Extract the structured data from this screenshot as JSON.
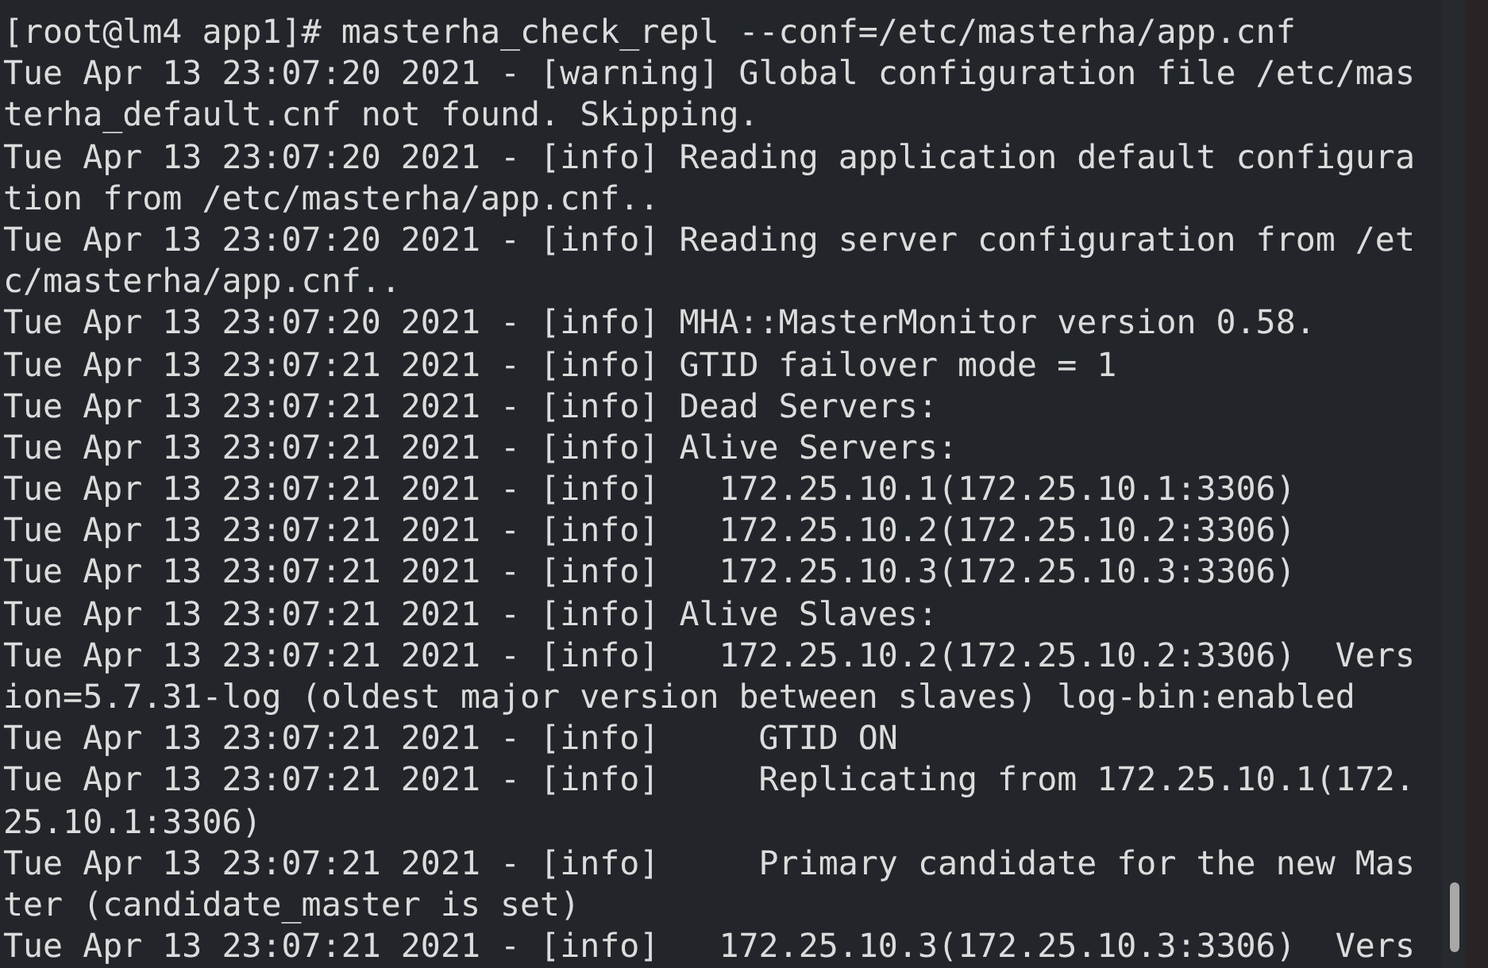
{
  "terminal": {
    "lines": [
      "[root@lm4 app1]# masterha_check_repl --conf=/etc/masterha/app.cnf",
      "Tue Apr 13 23:07:20 2021 - [warning] Global configuration file /etc/mas",
      "terha_default.cnf not found. Skipping.",
      "Tue Apr 13 23:07:20 2021 - [info] Reading application default configura",
      "tion from /etc/masterha/app.cnf..",
      "Tue Apr 13 23:07:20 2021 - [info] Reading server configuration from /et",
      "c/masterha/app.cnf..",
      "Tue Apr 13 23:07:20 2021 - [info] MHA::MasterMonitor version 0.58.",
      "Tue Apr 13 23:07:21 2021 - [info] GTID failover mode = 1",
      "Tue Apr 13 23:07:21 2021 - [info] Dead Servers:",
      "Tue Apr 13 23:07:21 2021 - [info] Alive Servers:",
      "Tue Apr 13 23:07:21 2021 - [info]   172.25.10.1(172.25.10.1:3306)",
      "Tue Apr 13 23:07:21 2021 - [info]   172.25.10.2(172.25.10.2:3306)",
      "Tue Apr 13 23:07:21 2021 - [info]   172.25.10.3(172.25.10.3:3306)",
      "Tue Apr 13 23:07:21 2021 - [info] Alive Slaves:",
      "Tue Apr 13 23:07:21 2021 - [info]   172.25.10.2(172.25.10.2:3306)  Vers",
      "ion=5.7.31-log (oldest major version between slaves) log-bin:enabled",
      "Tue Apr 13 23:07:21 2021 - [info]     GTID ON",
      "Tue Apr 13 23:07:21 2021 - [info]     Replicating from 172.25.10.1(172.",
      "25.10.1:3306)",
      "Tue Apr 13 23:07:21 2021 - [info]     Primary candidate for the new Mas",
      "ter (candidate_master is set)",
      "Tue Apr 13 23:07:21 2021 - [info]   172.25.10.3(172.25.10.3:3306)  Vers"
    ]
  }
}
